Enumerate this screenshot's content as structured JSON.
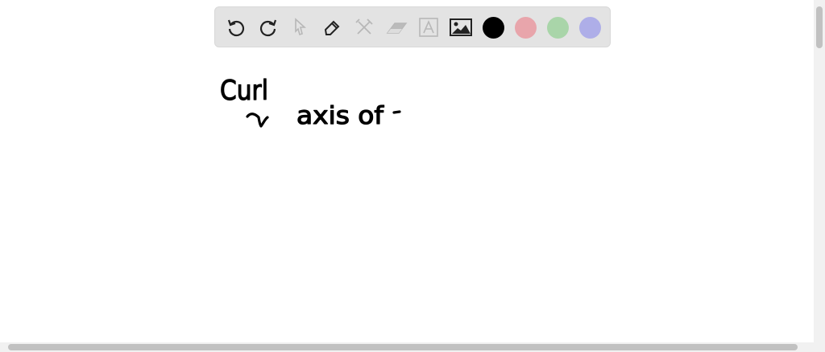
{
  "toolbar": {
    "tools": [
      "undo-icon",
      "redo-icon",
      "select-icon",
      "pen-icon",
      "tools-icon",
      "eraser-icon",
      "text-icon",
      "image-icon"
    ],
    "colors": [
      "#000000",
      "#e8a5ab",
      "#a9d5a9",
      "#aeaee8"
    ]
  },
  "canvas": {
    "handwriting": [
      "Curl",
      "axis of"
    ]
  }
}
